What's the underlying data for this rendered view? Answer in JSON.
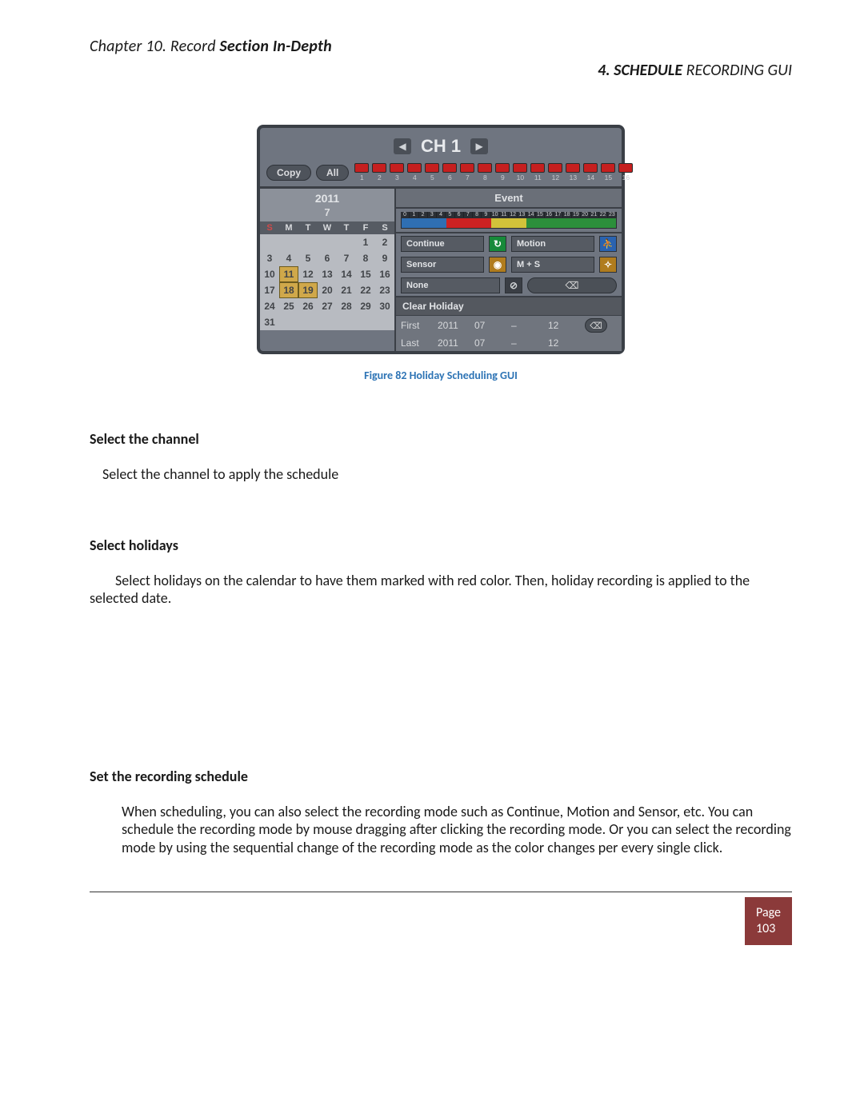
{
  "header": {
    "left_prefix": "Chapter 10. Record ",
    "left_bold": "Section In-Depth",
    "right_bold": "4. SCHEDULE ",
    "right_suffix": "RECORDING GUI"
  },
  "gui": {
    "channel_label": "CH 1",
    "copy": "Copy",
    "all": "All",
    "channel_nums": [
      "1",
      "2",
      "3",
      "4",
      "5",
      "6",
      "7",
      "8",
      "9",
      "10",
      "11",
      "12",
      "13",
      "14",
      "15",
      "16"
    ],
    "event_title": "Event",
    "hours": [
      "0",
      "1",
      "2",
      "3",
      "4",
      "5",
      "6",
      "7",
      "8",
      "9",
      "10",
      "11",
      "12",
      "13",
      "14",
      "15",
      "16",
      "17",
      "18",
      "19",
      "20",
      "21",
      "22",
      "23"
    ],
    "modes": {
      "continue": "Continue",
      "motion": "Motion",
      "sensor": "Sensor",
      "ms": "M + S",
      "none": "None"
    },
    "calendar": {
      "year": "2011",
      "month": "7",
      "dow": [
        "S",
        "M",
        "T",
        "W",
        "T",
        "F",
        "S"
      ],
      "cells": [
        "",
        "",
        "",
        "",
        "",
        "1",
        "2",
        "3",
        "4",
        "5",
        "6",
        "7",
        "8",
        "9",
        "10",
        "11",
        "12",
        "13",
        "14",
        "15",
        "16",
        "17",
        "18",
        "19",
        "20",
        "21",
        "22",
        "23",
        "24",
        "25",
        "26",
        "27",
        "28",
        "29",
        "30",
        "31",
        "",
        "",
        "",
        "",
        "",
        ""
      ],
      "highlighted": [
        "11",
        "18",
        "19"
      ]
    },
    "clear_holiday": "Clear Holiday",
    "first": {
      "label": "First",
      "y": "2011",
      "m": "07",
      "sep": "–",
      "d": "12"
    },
    "last": {
      "label": "Last",
      "y": "2011",
      "m": "07",
      "sep": "–",
      "d": "12"
    }
  },
  "caption": "Figure 82 Holiday Scheduling GUI",
  "sections": {
    "s1h": "Select the channel",
    "s1p": "Select the channel to apply the schedule",
    "s2h": "Select holidays",
    "s2p": "Select holidays on the calendar to have them marked with red color. Then, holiday recording is applied to the selected date.",
    "s3h": "Set the recording schedule",
    "s3p": "When scheduling, you can also select the recording mode such as Continue, Motion and Sensor, etc. You can schedule the recording mode by mouse dragging after clicking the recording mode. Or you can select the recording mode by using the sequential change of the recording mode as the color changes per every single click."
  },
  "footer": {
    "page_word": "Page",
    "page_num": "103"
  }
}
